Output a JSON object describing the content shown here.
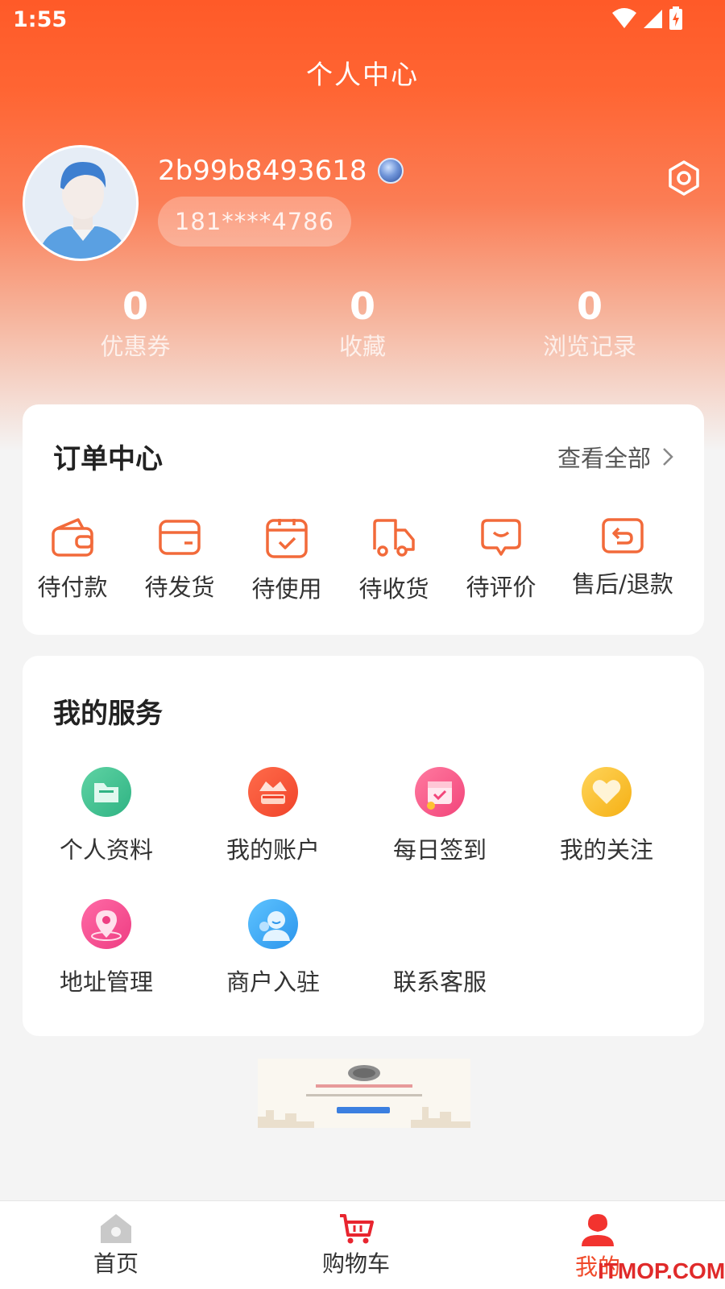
{
  "status_bar": {
    "time": "1:55"
  },
  "header": {
    "title": "个人中心"
  },
  "profile": {
    "username": "2b99b8493618",
    "phone": "181****4786"
  },
  "stats": [
    {
      "value": "0",
      "label": "优惠券"
    },
    {
      "value": "0",
      "label": "收藏"
    },
    {
      "value": "0",
      "label": "浏览记录"
    }
  ],
  "orders": {
    "title": "订单中心",
    "view_all": "查看全部",
    "items": [
      {
        "label": "待付款",
        "icon": "wallet-icon"
      },
      {
        "label": "待发货",
        "icon": "card-box-icon"
      },
      {
        "label": "待使用",
        "icon": "checked-box-icon"
      },
      {
        "label": "待收货",
        "icon": "truck-icon"
      },
      {
        "label": "待评价",
        "icon": "chat-icon"
      },
      {
        "label": "售后/退款",
        "icon": "return-icon"
      }
    ]
  },
  "services": {
    "title": "我的服务",
    "items": [
      {
        "label": "个人资料",
        "icon": "folder-icon"
      },
      {
        "label": "我的账户",
        "icon": "account-icon"
      },
      {
        "label": "每日签到",
        "icon": "calendar-icon"
      },
      {
        "label": "我的关注",
        "icon": "heart-icon"
      },
      {
        "label": "地址管理",
        "icon": "location-icon"
      },
      {
        "label": "商户入驻",
        "icon": "merchant-icon"
      },
      {
        "label": "联系客服",
        "icon": ""
      }
    ]
  },
  "bottom_nav": [
    {
      "label": "首页",
      "icon": "home-icon"
    },
    {
      "label": "购物车",
      "icon": "cart-icon"
    },
    {
      "label": "我的",
      "icon": "profile-icon"
    }
  ],
  "watermark": "ITMOP.COM",
  "colors": {
    "accent": "#ff5a28",
    "icon_orange": "#f26a3a",
    "nav_active": "#f04a2a"
  }
}
